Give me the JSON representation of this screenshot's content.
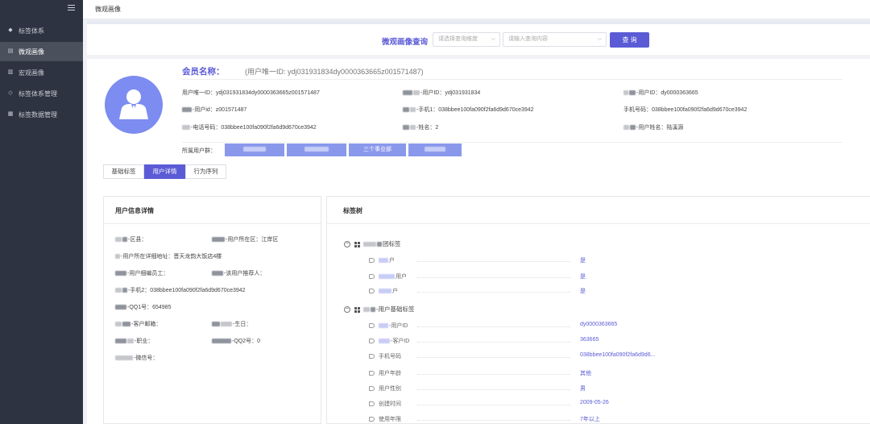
{
  "sidebar": {
    "items": [
      {
        "label": "标签体系",
        "icon": "tag-icon"
      },
      {
        "label": "微观画像",
        "icon": "profile-icon"
      },
      {
        "label": "宏观画像",
        "icon": "chart-icon"
      },
      {
        "label": "标签体系管理",
        "icon": "tag-manage-icon"
      },
      {
        "label": "标签数据管理",
        "icon": "data-manage-icon"
      }
    ]
  },
  "header": {
    "title": "微观画像"
  },
  "query": {
    "label": "微观画像查询",
    "type_placeholder": "请选择查询维度",
    "content_placeholder": "请输入查询内容",
    "button": "查 询"
  },
  "profile": {
    "name_label": "会员名称：",
    "uid_text": "(用户唯一ID: ydj031931834dy0000363665z001571487)",
    "fields": {
      "uid": "用户唯一ID：ydj031931834dy0000363665z001571487",
      "userid1": "-用户ID：ydj031931834",
      "userid2": "-用户ID：dy0000363665",
      "userid3": "-用户id：z001571487",
      "mobile1": "-手机1：038bbee100fa090f2fa6d9d670ce3942",
      "mobile": "手机号码：038bbee100fa090f2fa6d9d670ce3942",
      "phone": "-电话号码：038bbee100fa090f2fa6d9d670ce3942",
      "surname": "-姓名：2",
      "username": "-用户姓名：陆溪源"
    },
    "group_label": "所属用户群：",
    "group_tags": [
      "",
      "",
      "三个事业部",
      ""
    ]
  },
  "tabs": [
    {
      "label": "基础标签"
    },
    {
      "label": "用户详情"
    },
    {
      "label": "行为序列"
    }
  ],
  "user_info": {
    "title": "用户信息详情",
    "fields": {
      "district": "-区县：",
      "user_district": "-用户所在区：江岸区",
      "address": "-用户所在详细地址：晋天龙韵大饭店4楼",
      "employee": "-用户细编员工：",
      "referrer": "-该用户推荐人：",
      "mobile2": "-手机2：038bbee100fa090f2fa6d9d670ce3942",
      "qq1": "-QQ1号：654985",
      "email": "-客户邮箱：",
      "birthday": "-生日：",
      "job": "-职业：",
      "qq2": "-QQ2号：0",
      "wechat": "-微信号："
    }
  },
  "tag_tree": {
    "title": "标签树",
    "groups": [
      {
        "name": "团标签",
        "rows": [
          {
            "label": "户",
            "value": "是"
          },
          {
            "label": "用户",
            "value": "是"
          },
          {
            "label": "户",
            "value": "是"
          }
        ]
      },
      {
        "name": "-用户基础标签",
        "rows": [
          {
            "label": "-用户ID",
            "value": "dy0000363665"
          },
          {
            "label": "-客户ID",
            "value": "363665"
          },
          {
            "label": "手机号码",
            "value": "038bbee100fa090f2fa6d9d6..."
          },
          {
            "label": "用户年龄",
            "value": "其他"
          },
          {
            "label": "用户性别",
            "value": "男"
          },
          {
            "label": "创建时间",
            "value": "2009-05-26"
          },
          {
            "label": "使用年限",
            "value": "7年以上"
          }
        ]
      }
    ]
  },
  "colors": {
    "accent": "#5b5bd6",
    "sidebar": "#2d3340",
    "avatar": "#7d8cf0"
  }
}
